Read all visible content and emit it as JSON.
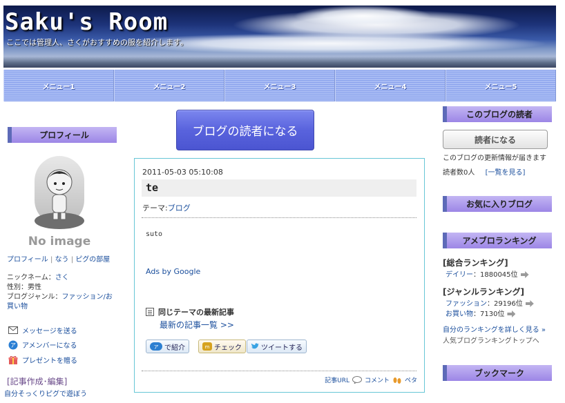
{
  "header": {
    "title": "Saku's Room",
    "description": "ここでは管理人、さくがおすすめの服を紹介します。"
  },
  "menu": [
    "メニュー1",
    "メニュー2",
    "メニュー3",
    "メニュー4",
    "メニュー5"
  ],
  "left": {
    "profile_heading": "プロフィール",
    "no_image": "No image",
    "profile_links": [
      "プロフィール",
      "なう",
      "ピグの部屋"
    ],
    "nickname_label": "ニックネーム：",
    "nickname": "さく",
    "gender": "性別：男性",
    "genre_label": "ブログジャンル：",
    "genre": "ファッション/お買い物",
    "actions": [
      {
        "icon": "envelope-icon",
        "label": "メッセージを送る"
      },
      {
        "icon": "amember-icon",
        "label": "アメンバーになる"
      },
      {
        "icon": "gift-icon",
        "label": "プレゼントを贈る"
      }
    ],
    "edit_link": "[記事作成･編集]",
    "pig_link": "自分そっくりピグで遊ぼう"
  },
  "center": {
    "reader_banner": "ブログの読者になる",
    "entry": {
      "date": "2011-05-03 05:10:08",
      "title": "te",
      "theme_label": "テーマ:",
      "theme": "ブログ",
      "body": "suto",
      "ads": "Ads by Google",
      "same_theme": "同じテーマの最新記事",
      "latest_list": "最新の記事一覧 >>",
      "share": [
        "で紹介",
        "チェック",
        "ツイートする"
      ],
      "footer": [
        "記事URL",
        "コメント",
        "ペタ"
      ]
    }
  },
  "right": {
    "readers_heading": "このブログの読者",
    "reader_button": "読者になる",
    "reader_note": "このブログの更新情報が届きます",
    "reader_count": "読者数0人",
    "reader_list": "[一覧を見る]",
    "favorites_heading": "お気に入りブログ",
    "ranking_heading": "アメブロランキング",
    "overall_heading": "[総合ランキング]",
    "daily_label": "デイリー",
    "daily_value": "：1880045位",
    "genre_heading": "[ジャンルランキング]",
    "fashion_label": "ファッション",
    "fashion_value": "：29196位",
    "shopping_label": "お買い物",
    "shopping_value": "：7130位",
    "ranking_detail": "自分のランキングを詳しく見る »",
    "ranking_top": "人気ブログランキングトップへ",
    "bookmark_heading": "ブックマーク"
  },
  "colors": {
    "accent_blue": "#5963dd",
    "side_header": "#9c86e6",
    "link": "#1a4e9c",
    "article_border": "#66c6d6"
  }
}
